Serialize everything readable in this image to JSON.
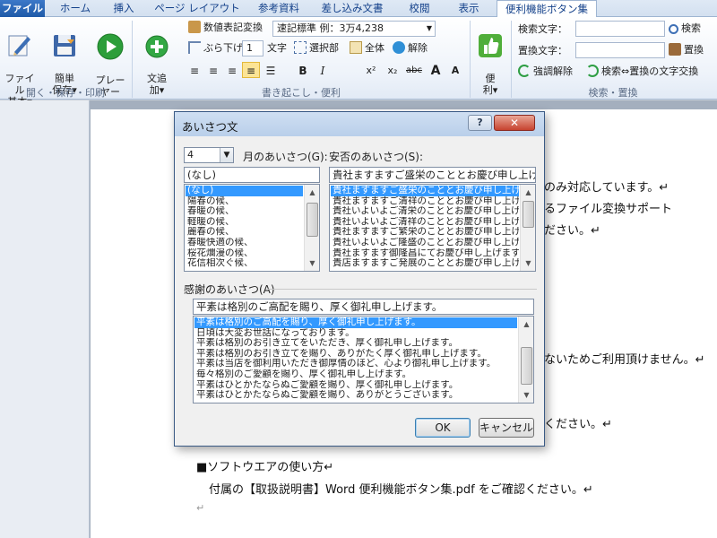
{
  "ribbon": {
    "tabs": [
      "ファイル",
      "ホーム",
      "挿入",
      "ページ レイアウト",
      "参考資料",
      "差し込み文書",
      "校閲",
      "表示",
      "便利機能ボタン集"
    ],
    "file_group": {
      "label": "開く・保存・印刷",
      "buttons": [
        "ファイル\n基本▾",
        "簡単\n保存▾",
        "プレー\nヤー"
      ]
    },
    "writing_group": {
      "label": "書き起こし・便利",
      "add_button": "文追\n加▾",
      "number_convert": "数値表記変換",
      "number_format_value": "速記標準  例：3万4,238",
      "hanging_indent": "ぶら下げ",
      "hanging_value": "1",
      "char_unit": "文字",
      "select_part": "選択部",
      "select_all": "全体",
      "release": "解除",
      "format_buttons": [
        "B",
        "I",
        "x²",
        "x₂",
        "abc",
        "A",
        "A"
      ]
    },
    "convenience_button": "便\n利▾",
    "search_group": {
      "label": "検索・置換",
      "search_label": "検索文字：",
      "replace_label": "置換文字：",
      "search_button": "検索",
      "replace_button": "置換",
      "highlight_release": "強調解除",
      "swap_text": "検索⇔置換の文字交換"
    }
  },
  "document": {
    "lines": [
      "のみ対応しています。↵",
      "るファイル変換サポート",
      "ださい。↵",
      "ないためご利用頂けません。↵",
      "ください。↵",
      "■ソフトウエアの使い方↵",
      "付属の【取扱説明書】Word 便利機能ボタン集.pdf をご確認ください。↵",
      "↵"
    ]
  },
  "dialog": {
    "title": "あいさつ文",
    "help": "?",
    "close": "✕",
    "month_value": "4",
    "month_label": "月のあいさつ(G):",
    "safety_label": "安否のあいさつ(S):",
    "month_text": "(なし)",
    "safety_text": "貴社ますますご盛栄のこととお慶び申し上げます。",
    "month_items": [
      "(なし)",
      "陽春の候、",
      "春暖の候、",
      "軽暖の候、",
      "麗春の候、",
      "春暖快適の候、",
      "桜花爛漫の候、",
      "花信相次ぐ候、"
    ],
    "safety_items": [
      "貴社ますますご盛栄のこととお慶び申し上げます。",
      "貴社ますますご清祥のこととお慶び申し上げます。",
      "貴社いよいよご清栄のこととお慶び申し上げます。",
      "貴社いよいよご清祥のこととお慶び申し上げます。",
      "貴社ますますご繁栄のこととお慶び申し上げます。",
      "貴社いよいよご隆盛のこととお慶び申し上げます。",
      "貴社ますます御隆昌にてお慶び申し上げます。",
      "貴店ますますご発展のこととお慶び申し上げます。"
    ],
    "thanks_label": "感謝のあいさつ(A)",
    "thanks_text": "平素は格別のご高配を賜り、厚く御礼申し上げます。",
    "thanks_items": [
      "平素は格別のご高配を賜り、厚く御礼申し上げます。",
      "日頃は大変お世話になっております。",
      "平素は格別のお引き立てをいただき、厚く御礼申し上げます。",
      "平素は格別のお引き立てを賜り、ありがたく厚く御礼申し上げます。",
      "平素は当店を御利用いただき御厚情のほど、心より御礼申し上げます。",
      "毎々格別のご愛顧を賜り、厚く御礼申し上げます。",
      "平素はひとかたならぬご愛顧を賜り、厚く御礼申し上げます。",
      "平素はひとかたならぬご愛顧を賜り、ありがとうございます。"
    ],
    "ok": "OK",
    "cancel": "キャンセル"
  },
  "colors": {
    "file_tab": "#2a66b8",
    "selection": "#3399ff",
    "ribbon_text": "#15428b"
  }
}
